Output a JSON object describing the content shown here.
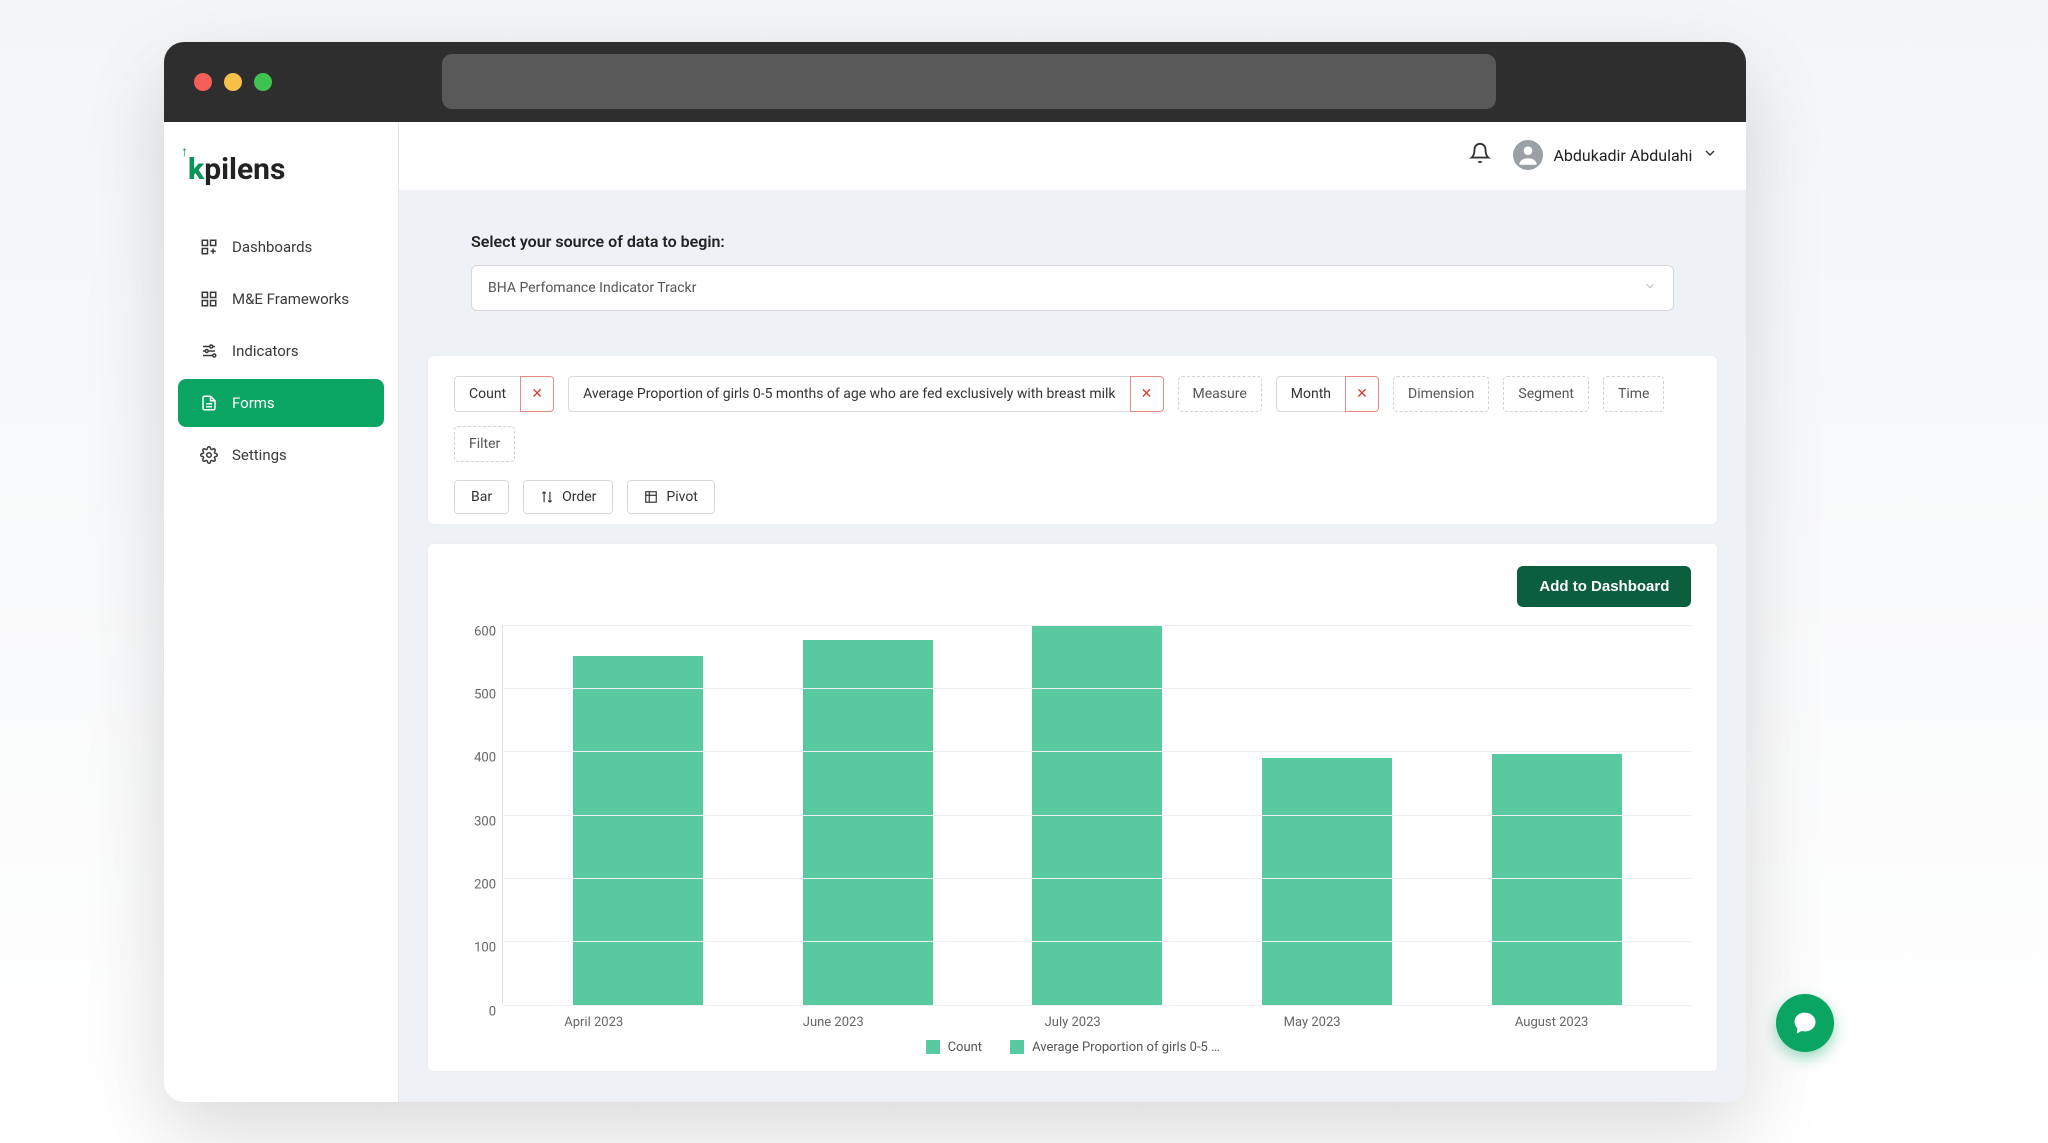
{
  "logo": {
    "text": "pilens",
    "prefix": "k"
  },
  "nav": {
    "items": [
      {
        "label": "Dashboards",
        "name": "sidebar-item-dashboards"
      },
      {
        "label": "M&E Frameworks",
        "name": "sidebar-item-frameworks"
      },
      {
        "label": "Indicators",
        "name": "sidebar-item-indicators"
      },
      {
        "label": "Forms",
        "name": "sidebar-item-forms"
      },
      {
        "label": "Settings",
        "name": "sidebar-item-settings"
      }
    ],
    "active_index": 3
  },
  "topbar": {
    "user_name": "Abdukadir Abdulahi"
  },
  "source": {
    "label": "Select your source of data to begin:",
    "value": "BHA Perfomance Indicator Trackr"
  },
  "chips": {
    "count": "Count",
    "metric": "Average Proportion of girls 0-5 months of age who are fed exclusively with breast milk",
    "measure": "Measure",
    "month": "Month",
    "dimension": "Dimension",
    "segment": "Segment",
    "time": "Time",
    "filter": "Filter"
  },
  "controls": {
    "bar": "Bar",
    "order": "Order",
    "pivot": "Pivot"
  },
  "chart_actions": {
    "add": "Add to Dashboard"
  },
  "legend": {
    "a": "Count",
    "b": "Average Proportion of girls 0-5 …"
  },
  "chart_data": {
    "type": "bar",
    "title": "",
    "xlabel": "",
    "ylabel": "",
    "ylim": [
      0,
      600
    ],
    "yticks": [
      0,
      100,
      200,
      300,
      400,
      500,
      600
    ],
    "categories": [
      "April 2023",
      "June 2023",
      "July 2023",
      "May 2023",
      "August 2023"
    ],
    "series": [
      {
        "name": "Count / Average Proportion of girls 0-5 …",
        "values": [
          550,
          575,
          600,
          390,
          395
        ]
      }
    ],
    "colors": {
      "bar": "#59caa0",
      "accent": "#0aa463",
      "button": "#0c5f3d"
    }
  }
}
